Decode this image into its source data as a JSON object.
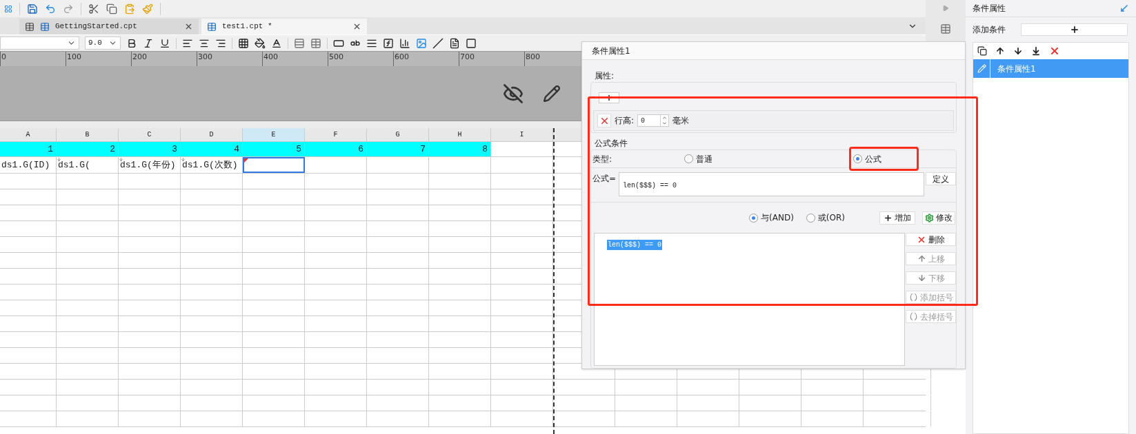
{
  "tabs": [
    {
      "label": "GettingStarted.cpt",
      "selected": false
    },
    {
      "label": "test1.cpt *",
      "selected": true
    }
  ],
  "format_bar": {
    "font_size": "9.0"
  },
  "ruler": [
    "0",
    "100",
    "200",
    "300",
    "400",
    "500",
    "600",
    "700",
    "800"
  ],
  "sheet": {
    "columns": [
      {
        "label": "A",
        "selected": false
      },
      {
        "label": "B",
        "selected": false
      },
      {
        "label": "C",
        "selected": false
      },
      {
        "label": "D",
        "selected": false
      },
      {
        "label": "E",
        "selected": true
      },
      {
        "label": "F",
        "selected": false
      },
      {
        "label": "G",
        "selected": false
      },
      {
        "label": "H",
        "selected": false
      },
      {
        "label": "I",
        "selected": false
      }
    ],
    "rows": [
      {
        "kind": "number",
        "cells": [
          {
            "text": "1"
          },
          {
            "text": "2"
          },
          {
            "text": "3"
          },
          {
            "text": "4"
          },
          {
            "text": "5"
          },
          {
            "text": "6"
          },
          {
            "text": "7"
          },
          {
            "text": "8"
          }
        ]
      },
      {
        "kind": "data",
        "cells": [
          {
            "text": "ds1.G(ID)",
            "expand": false,
            "selected": false,
            "flagged": false
          },
          {
            "text": "ds1.G(",
            "expand": true,
            "selected": false,
            "flagged": false
          },
          {
            "text": "ds1.G(年份)",
            "expand": true,
            "selected": false,
            "flagged": false
          },
          {
            "text": "ds1.G(次数)",
            "expand": true,
            "selected": false,
            "flagged": false
          },
          {
            "expand": false,
            "selected": true,
            "flagged": true
          }
        ]
      }
    ]
  },
  "dialog": {
    "title": "条件属性1",
    "properties_label": "属性:",
    "row_height": {
      "label": "行高:",
      "value": "0",
      "unit": "毫米"
    },
    "formula_section": "公式条件",
    "type_label": "类型:",
    "types": [
      {
        "label": "普通",
        "selected": false
      },
      {
        "label": "公式",
        "selected": true
      }
    ],
    "formula_label": "公式=",
    "formula": "len($$$) == 0",
    "define_button": "定义",
    "logic": [
      {
        "label": "与(AND)",
        "selected": true
      },
      {
        "label": "或(OR)",
        "selected": false
      }
    ],
    "add_button": "增加",
    "modify_button": "修改",
    "conditions": [
      {
        "text": "len($$$) == 0",
        "selected": true
      }
    ],
    "side_buttons": [
      {
        "kind": "delete",
        "label": "删除",
        "disabled": false
      },
      {
        "kind": "up",
        "label": "上移",
        "disabled": true
      },
      {
        "kind": "down",
        "label": "下移",
        "disabled": true
      },
      {
        "kind": "add_paren",
        "label": "添加括号",
        "disabled": true
      },
      {
        "kind": "remove_paren",
        "label": "去掉括号",
        "disabled": true
      }
    ]
  },
  "panel": {
    "title": "条件属性",
    "add_label": "添加条件",
    "items": [
      {
        "label": "条件属性1",
        "selected": true
      }
    ]
  }
}
